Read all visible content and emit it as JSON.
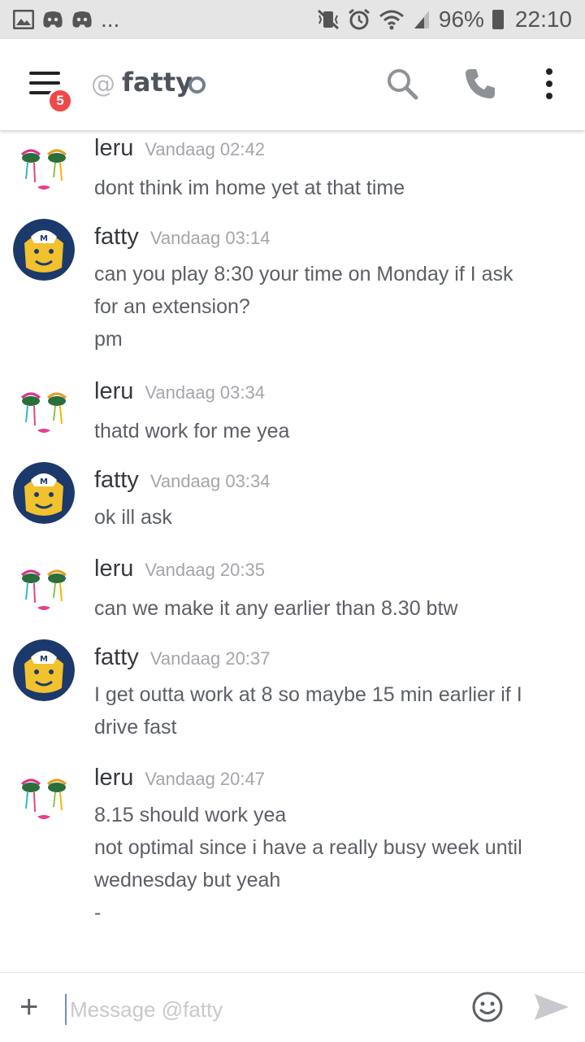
{
  "status_bar": {
    "left_icons": [
      "gallery-icon",
      "discord-icon",
      "discord-icon"
    ],
    "more": "...",
    "right_icons": [
      "mute-vibrate-icon",
      "alarm-icon",
      "wifi-icon",
      "signal-icon"
    ],
    "battery": "96%",
    "time": "22:10"
  },
  "header": {
    "badge_count": "5",
    "at_symbol": "@",
    "channel_name": "fatty",
    "status": "offline"
  },
  "messages": [
    {
      "author": "leru",
      "timestamp": "Vandaag 02:42",
      "avatar": "leru-avatar",
      "lines": [
        "dont think im home yet at that time"
      ]
    },
    {
      "author": "fatty",
      "timestamp": "Vandaag 03:14",
      "avatar": "fatty-avatar",
      "lines": [
        "can you play 8:30 your time on Monday if I ask",
        "for an extension?",
        "pm"
      ]
    },
    {
      "author": "leru",
      "timestamp": "Vandaag 03:34",
      "avatar": "leru-avatar",
      "lines": [
        "thatd work for me yea"
      ]
    },
    {
      "author": "fatty",
      "timestamp": "Vandaag 03:34",
      "avatar": "fatty-avatar",
      "lines": [
        "ok ill ask"
      ]
    },
    {
      "author": "leru",
      "timestamp": "Vandaag 20:35",
      "avatar": "leru-avatar",
      "lines": [
        "can we make it any earlier than 8.30 btw"
      ]
    },
    {
      "author": "fatty",
      "timestamp": "Vandaag 20:37",
      "avatar": "fatty-avatar",
      "lines": [
        "I get outta work at 8 so maybe 15 min earlier if I",
        "drive fast"
      ]
    },
    {
      "author": "leru",
      "timestamp": "Vandaag 20:47",
      "avatar": "leru-avatar",
      "lines": [
        "8.15 should work yea",
        "not optimal since i have a really busy week until",
        "wednesday but yeah",
        "-"
      ]
    }
  ],
  "composer": {
    "plus": "+",
    "placeholder": "Message @fatty",
    "value": ""
  },
  "colors": {
    "accent": "#7289da",
    "badge": "#f04747",
    "status_bar": "#e5e5e5"
  }
}
